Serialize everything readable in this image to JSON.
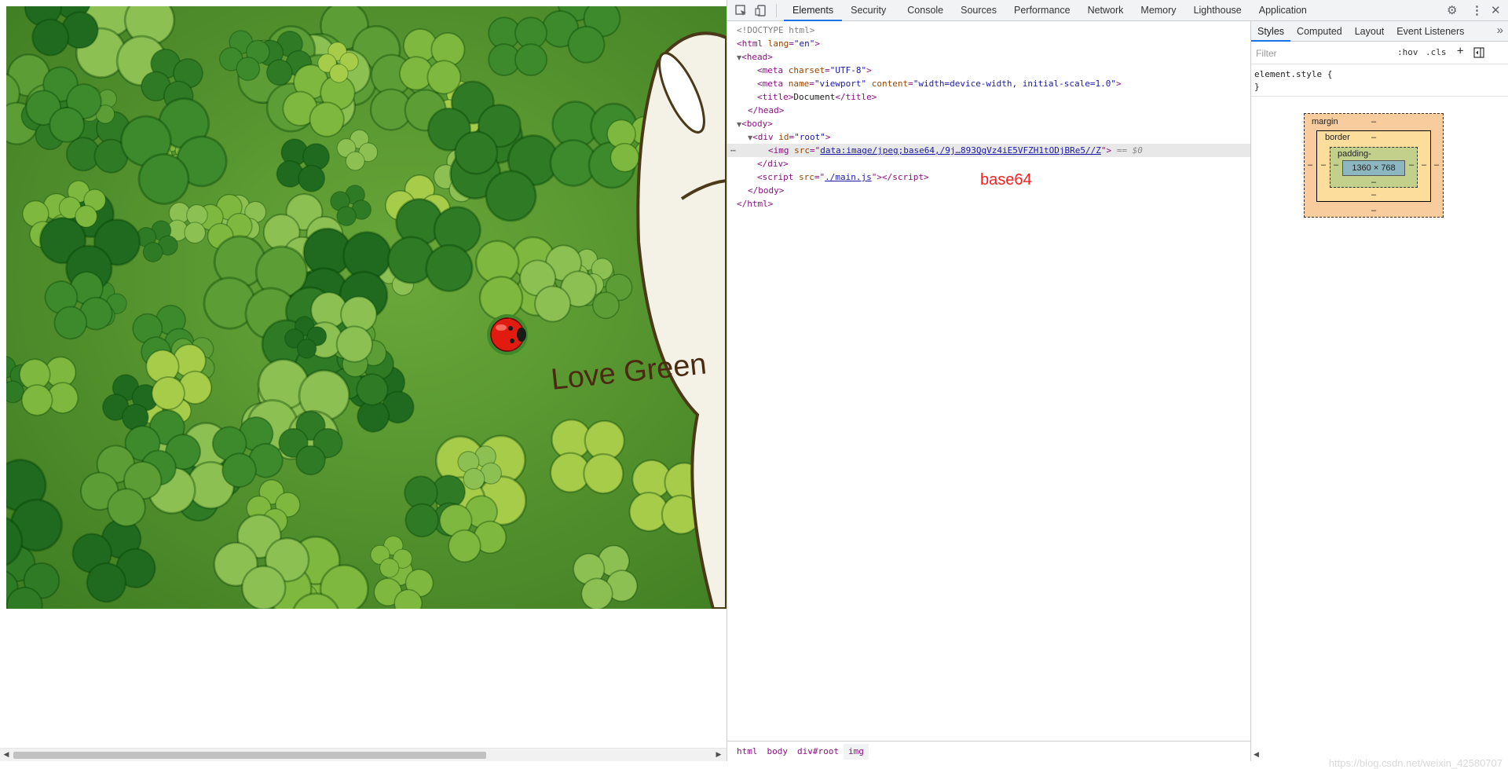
{
  "devtools": {
    "tabs": [
      "Elements",
      "Security",
      "Console",
      "Sources",
      "Performance",
      "Network",
      "Memory",
      "Lighthouse",
      "Application"
    ],
    "active_tab": "Elements"
  },
  "image": {
    "caption_text": "Love Green"
  },
  "dom": {
    "l1": "<!DOCTYPE html>",
    "html_attr": "lang",
    "html_val": "\"en\"",
    "meta1_attr": "charset",
    "meta1_val": "\"UTF-8\"",
    "meta2_attr1": "name",
    "meta2_val1": "\"viewport\"",
    "meta2_attr2": "content",
    "meta2_val2": "\"width=device-width, initial-scale=1.0\"",
    "title_text": "Document",
    "div_attr": "id",
    "div_val": "\"root\"",
    "img_attr": "src",
    "img_val": "data:image/jpeg;base64,/9j…893QgVz4iE5VFZH1tODjBRe5//Z",
    "img_suffix": "== $0",
    "script_attr": "src",
    "script_val": "./main.js",
    "annotation": "base64"
  },
  "breadcrumbs": [
    "html",
    "body",
    "div#root",
    "img"
  ],
  "sidebar": {
    "tabs": [
      "Styles",
      "Computed",
      "Layout",
      "Event Listeners"
    ],
    "active_tab": "Styles",
    "filter_placeholder": "Filter",
    "hov": ":hov",
    "cls": ".cls",
    "rule_selector": "element.style {",
    "rule_close": "}"
  },
  "box_model": {
    "margin_label": "margin",
    "border_label": "border",
    "padding_label": "padding-",
    "content": "1360 × 768",
    "dash": "–"
  },
  "watermark": "https://blog.csdn.net/weixin_42580707"
}
